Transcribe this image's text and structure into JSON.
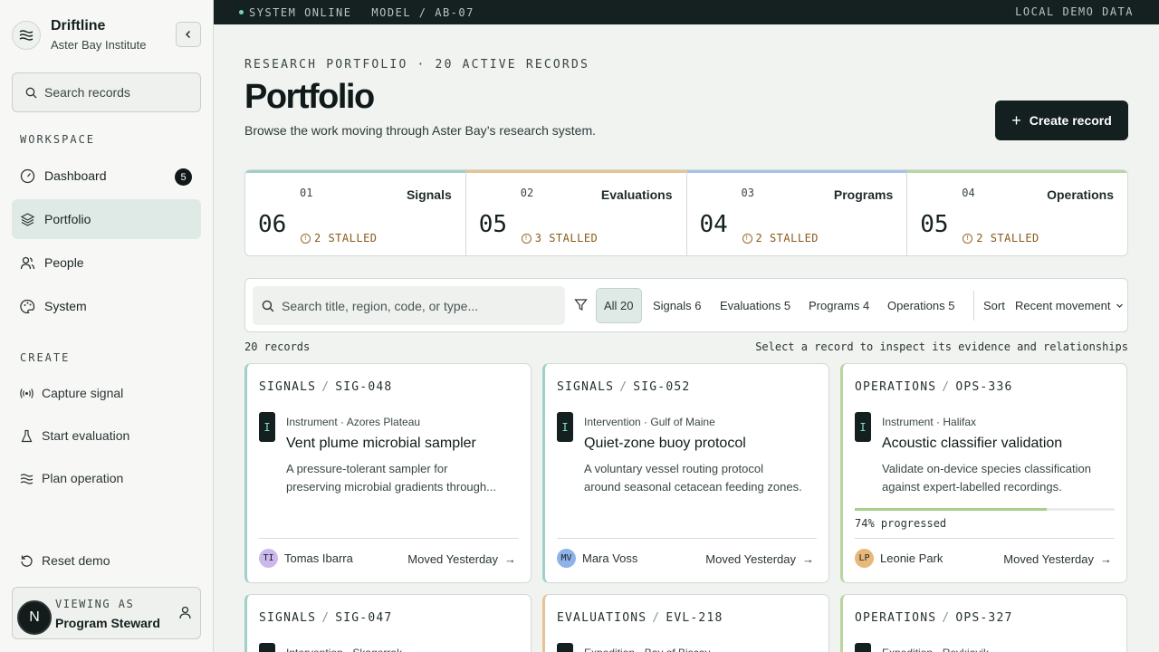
{
  "brand": {
    "name": "Driftline",
    "subtitle": "Aster Bay Institute"
  },
  "sidebar": {
    "search_placeholder": "Search records",
    "workspace_label": "WORKSPACE",
    "nav": [
      {
        "label": "Dashboard",
        "icon": "gauge-icon",
        "badge": "5"
      },
      {
        "label": "Portfolio",
        "icon": "layers-icon",
        "active": true
      },
      {
        "label": "People",
        "icon": "people-icon"
      },
      {
        "label": "System",
        "icon": "palette-icon"
      }
    ],
    "create_label": "CREATE",
    "create": [
      {
        "label": "Capture signal",
        "icon": "broadcast-icon"
      },
      {
        "label": "Start evaluation",
        "icon": "flask-icon"
      },
      {
        "label": "Plan operation",
        "icon": "waves-icon"
      }
    ],
    "reset_label": "Reset demo",
    "viewer": {
      "kicker": "VIEWING AS",
      "role": "Program Steward",
      "initial": "N"
    }
  },
  "topbar": {
    "status": "SYSTEM ONLINE",
    "model": "MODEL / AB-07",
    "right": "LOCAL DEMO DATA"
  },
  "header": {
    "kicker": "RESEARCH PORTFOLIO · 20 ACTIVE RECORDS",
    "title": "Portfolio",
    "subtitle": "Browse the work moving through Aster Bay’s research system.",
    "create_button": "Create record",
    "create_plus": "+"
  },
  "stats": [
    {
      "index": "01",
      "name": "Signals",
      "count": "06",
      "stalled": "2 STALLED",
      "color": "#9fd0c8"
    },
    {
      "index": "02",
      "name": "Evaluations",
      "count": "05",
      "stalled": "3 STALLED",
      "color": "#e6c394"
    },
    {
      "index": "03",
      "name": "Programs",
      "count": "04",
      "stalled": "2 STALLED",
      "color": "#a7c0e6"
    },
    {
      "index": "04",
      "name": "Operations",
      "count": "05",
      "stalled": "2 STALLED",
      "color": "#b8d6a0"
    }
  ],
  "filters": {
    "search_placeholder": "Search title, region, code, or type...",
    "chips": [
      "All 20",
      "Signals 6",
      "Evaluations 5",
      "Programs 4",
      "Operations 5"
    ],
    "sort_label": "Sort",
    "sort_value": "Recent movement"
  },
  "records_count": "20 records",
  "records_hint": "Select a record to inspect its evidence and relationships",
  "cards": [
    {
      "category": "SIGNALS",
      "code": "SIG-048",
      "tag": "I",
      "meta": "Instrument · Azores Plateau",
      "title": "Vent plume microbial sampler",
      "desc1": "A pressure-tolerant sampler for",
      "desc2": "preserving microbial gradients through...",
      "owner_initials": "TI",
      "owner": "Tomas Ibarra",
      "owner_color": "#cbb8ec",
      "moved": "Moved Yesterday",
      "accent": "#9fd0c8"
    },
    {
      "category": "SIGNALS",
      "code": "SIG-052",
      "tag": "I",
      "meta": "Intervention · Gulf of Maine",
      "title": "Quiet-zone buoy protocol",
      "desc1": "A voluntary vessel routing protocol",
      "desc2": "around seasonal cetacean feeding zones.",
      "owner_initials": "MV",
      "owner": "Mara Voss",
      "owner_color": "#8fb2e8",
      "moved": "Moved Yesterday",
      "accent": "#9fd0c8"
    },
    {
      "category": "OPERATIONS",
      "code": "OPS-336",
      "tag": "I",
      "meta": "Instrument · Halifax",
      "title": "Acoustic classifier validation",
      "desc1": "Validate on-device species classification",
      "desc2": "against expert-labelled recordings.",
      "progress": 74,
      "progress_label": "74% progressed",
      "owner_initials": "LP",
      "owner": "Leonie Park",
      "owner_color": "#e8b87a",
      "moved": "Moved Yesterday",
      "accent": "#b8d6a0"
    },
    {
      "category": "SIGNALS",
      "code": "SIG-047",
      "tag": "I",
      "meta": "Intervention · Skagerrak",
      "accent": "#9fd0c8"
    },
    {
      "category": "EVALUATIONS",
      "code": "EVL-218",
      "tag": "I",
      "meta": "Expedition · Bay of Biscay",
      "accent": "#e6c394"
    },
    {
      "category": "OPERATIONS",
      "code": "OPS-327",
      "tag": "I",
      "meta": "Expedition · Reykjavik",
      "accent": "#b8d6a0"
    }
  ]
}
